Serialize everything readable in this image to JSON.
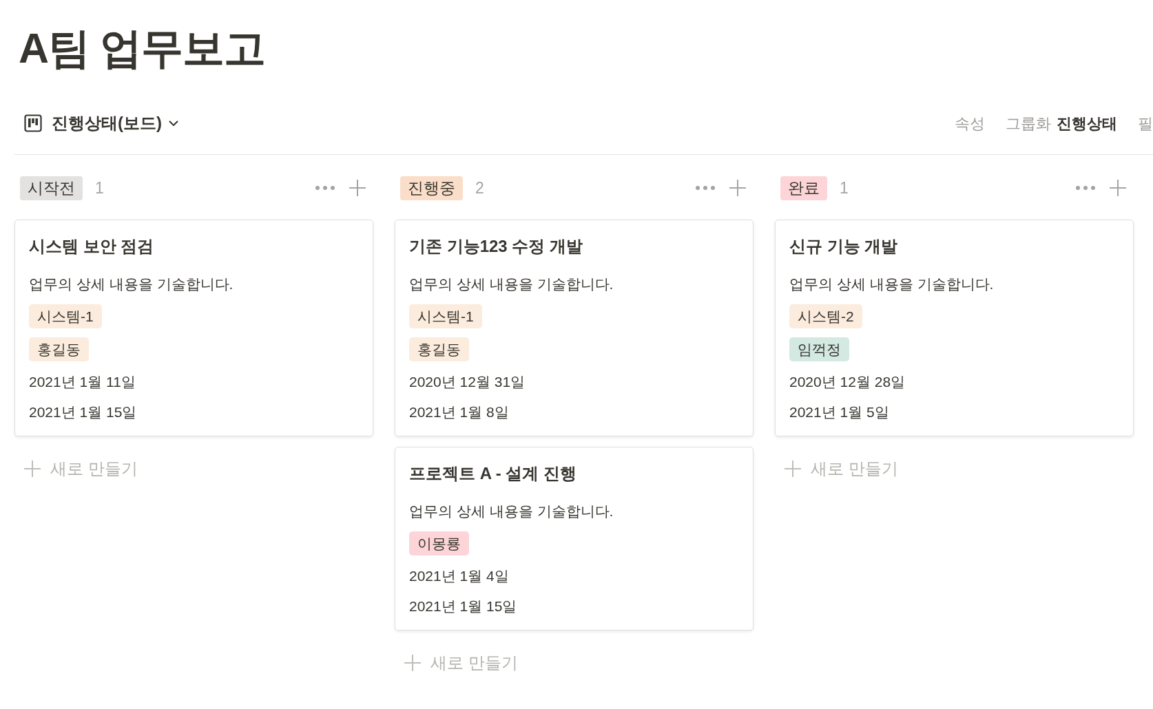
{
  "page_title": "A팀 업무보고",
  "view_bar": {
    "view_name": "진행상태(보드)",
    "actions": [
      {
        "label": "속성"
      },
      {
        "label": "그룹화",
        "value": "진행상태"
      },
      {
        "label": "필"
      }
    ]
  },
  "columns": [
    {
      "status": "시작전",
      "color": "#e3e2e0",
      "count": "1",
      "cards": [
        {
          "title": "시스템 보안 점검",
          "description": "업무의 상세 내용을 기술합니다.",
          "tags": [
            {
              "label": "시스템-1",
              "color": "#fbecdd"
            },
            {
              "label": "홍길동",
              "color": "#fbecdd"
            }
          ],
          "dates": [
            "2021년 1월 11일",
            "2021년 1월 15일"
          ]
        }
      ],
      "new_label": "새로 만들기"
    },
    {
      "status": "진행중",
      "color": "#fadec9",
      "count": "2",
      "cards": [
        {
          "title": "기존 기능123 수정 개발",
          "description": "업무의 상세 내용을 기술합니다.",
          "tags": [
            {
              "label": "시스템-1",
              "color": "#fbecdd"
            },
            {
              "label": "홍길동",
              "color": "#fbecdd"
            }
          ],
          "dates": [
            "2020년 12월 31일",
            "2021년 1월 8일"
          ]
        },
        {
          "title": "프로젝트 A - 설계 진행",
          "description": "업무의 상세 내용을 기술합니다.",
          "tags": [
            {
              "label": "이몽룡",
              "color": "#fdd5d8"
            }
          ],
          "dates": [
            "2021년 1월 4일",
            "2021년 1월 15일"
          ]
        }
      ],
      "new_label": "새로 만들기"
    },
    {
      "status": "완료",
      "color": "#fdd5d8",
      "count": "1",
      "cards": [
        {
          "title": "신규 기능 개발",
          "description": "업무의 상세 내용을 기술합니다.",
          "tags": [
            {
              "label": "시스템-2",
              "color": "#fbecdd"
            },
            {
              "label": "임꺽정",
              "color": "#d3e9e2"
            }
          ],
          "dates": [
            "2020년 12월 28일",
            "2021년 1월 5일"
          ]
        }
      ],
      "new_label": "새로 만들기"
    }
  ]
}
